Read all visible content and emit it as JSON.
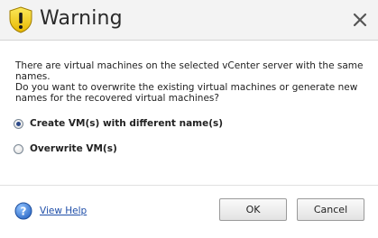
{
  "dialog": {
    "title": "Warning",
    "title_icon": "warning-icon",
    "close_icon": "close-icon"
  },
  "message": {
    "line1": "There are virtual machines on the selected vCenter server with the same names.",
    "line2": "Do you want to overwrite the existing virtual machines or generate new names for the recovered virtual machines?"
  },
  "options": [
    {
      "label": "Create VM(s) with different name(s)",
      "checked": true
    },
    {
      "label": "Overwrite VM(s)",
      "checked": false
    }
  ],
  "footer": {
    "help_icon": "help-icon",
    "help_label": "View Help",
    "ok_label": "OK",
    "cancel_label": "Cancel"
  },
  "colors": {
    "link": "#1f4ea8",
    "warning_fill": "#f2d21b",
    "help_fill": "#3b7fd9"
  }
}
